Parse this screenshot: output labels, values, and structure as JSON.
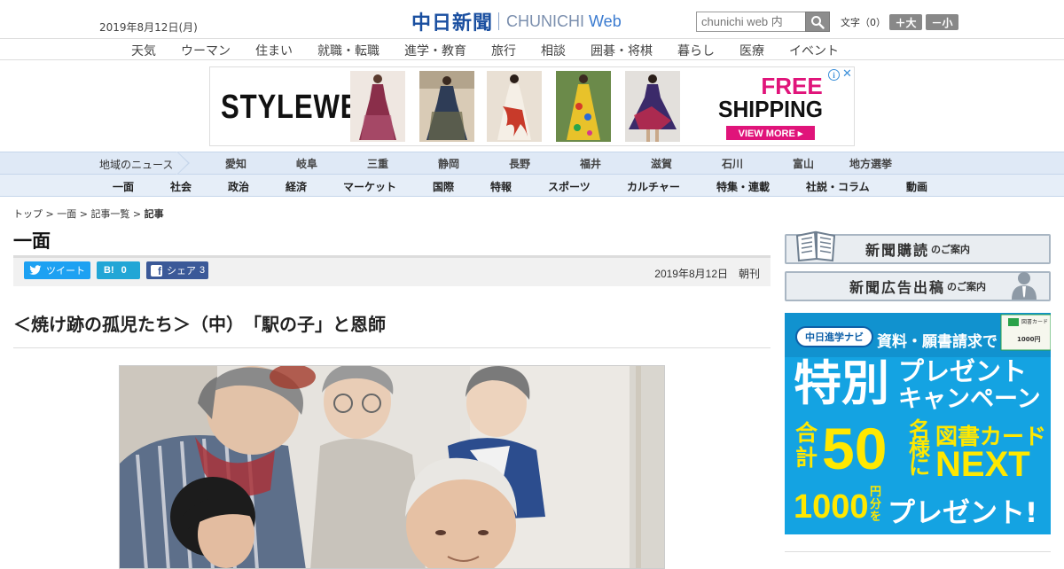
{
  "header": {
    "date": "2019年8月12日(月)",
    "logo_jp": "中日新聞",
    "logo_en": "CHUNICHI",
    "logo_web": "Web",
    "search_placeholder": "chunichi web 内",
    "font_label": "文字（0）",
    "font_larger": "＋大",
    "font_smaller": "－小"
  },
  "category_nav": [
    "天気",
    "ウーマン",
    "住まい",
    "就職・転職",
    "進学・教育",
    "旅行",
    "相談",
    "囲碁・将棋",
    "暮らし",
    "医療",
    "イベント"
  ],
  "ad_banner": {
    "brand": "STYLEWE",
    "headline1": "FREE",
    "headline2": "SHIPPING",
    "cta": "VIEW MORE ▸",
    "info": "i",
    "close": "✕",
    "colors": {
      "accent": "#e0147a"
    }
  },
  "region_nav": {
    "label": "地域のニュース",
    "items": [
      "愛知",
      "岐阜",
      "三重",
      "静岡",
      "長野",
      "福井",
      "滋賀",
      "石川",
      "富山",
      "地方選挙"
    ]
  },
  "section_nav": [
    "一面",
    "社会",
    "政治",
    "経済",
    "マーケット",
    "国際",
    "特報",
    "スポーツ",
    "カルチャー",
    "特集・連載",
    "社説・コラム",
    "動画"
  ],
  "breadcrumb": {
    "top": "トップ",
    "section": "一面",
    "list": "記事一覧",
    "current": "記事",
    "separator": " > "
  },
  "article": {
    "section_title": "一面",
    "share": {
      "tweet": "ツイート",
      "hatena_label": "B!",
      "hatena_count": "0",
      "facebook_label": "シェア",
      "facebook_count": "3"
    },
    "pub_date": "2019年8月12日　朝刊",
    "headline": "＜焼け跡の孤児たち＞（中）　「駅の子」と恩師"
  },
  "sidebar": {
    "subscribe_big": "新聞購読",
    "subscribe_small": "のご案内",
    "advert_big": "新聞広告出稿",
    "advert_small": "のご案内",
    "promo": {
      "site": "中日進学ナビ",
      "top": "資料・願書請求で",
      "special": "特別",
      "present": "プレゼント",
      "campaign": "キャンペーン",
      "total": "合計",
      "number": "50",
      "persons": "名様に",
      "prize1": "図書カード",
      "prize2": "NEXT",
      "amount": "1000",
      "yen": "円分を",
      "present2": "プレゼント!",
      "card_label": "図書カード NEXT",
      "card_value": "1000円"
    }
  }
}
